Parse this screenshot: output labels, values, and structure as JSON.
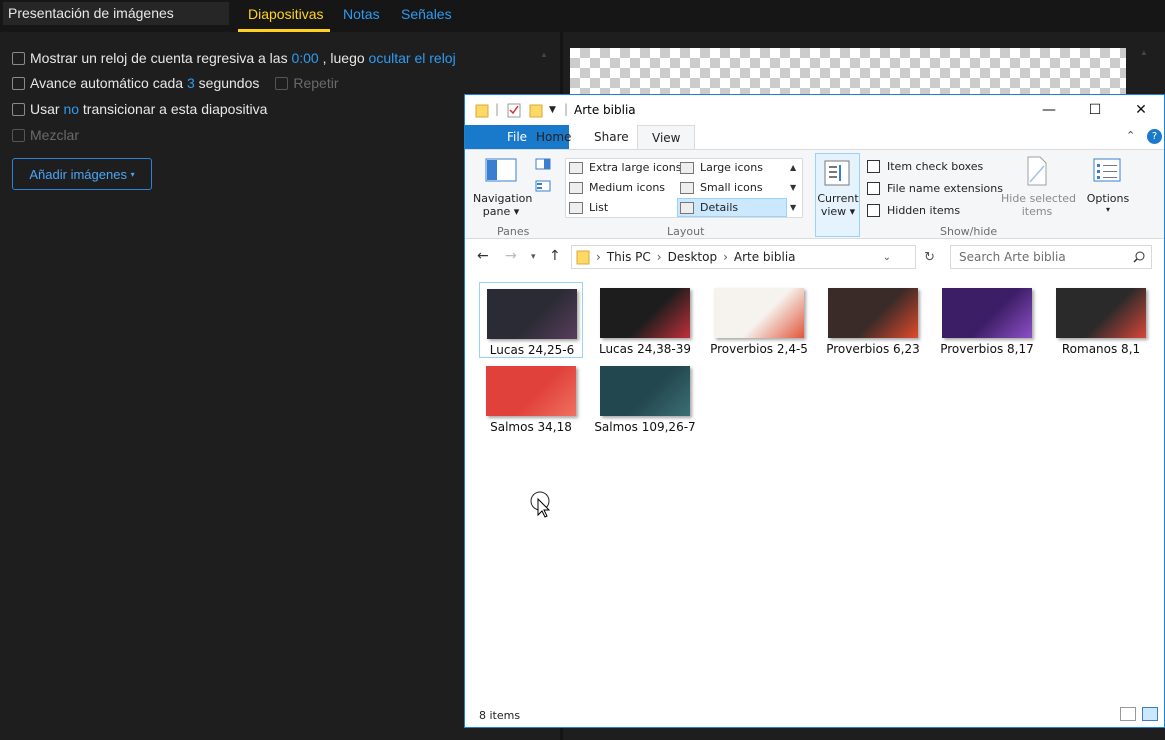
{
  "app": {
    "title_field": "Presentación de imágenes",
    "tabs": [
      "Diapositivas",
      "Notas",
      "Señales"
    ],
    "active_tab": "Diapositivas",
    "options": {
      "countdown": {
        "pre": "Mostrar un reloj de cuenta regresiva a las",
        "time": "0:00",
        "mid": ", luego",
        "link": "ocultar el reloj"
      },
      "auto_advance": {
        "pre": "Avance automático cada",
        "value": "3",
        "post": "segundos",
        "repeat": "Repetir"
      },
      "transition": {
        "pre": "Usar",
        "link": "no",
        "post": "transicionar a esta diapositiva"
      },
      "shuffle": "Mezclar"
    },
    "add_images_button": "Añadir imágenes",
    "caret": "▾"
  },
  "explorer": {
    "title": "Arte biblia",
    "controls": {
      "minimize": "—",
      "maximize": "☐",
      "close": "✕"
    },
    "ribbon_tabs": [
      "File",
      "Home",
      "Share",
      "View"
    ],
    "active_ribbon_tab": "View",
    "panes": {
      "nav_pane_line1": "Navigation",
      "nav_pane_line2": "pane",
      "group": "Panes"
    },
    "layout": {
      "items": [
        "Extra large icons",
        "Large icons",
        "Medium icons",
        "Small icons",
        "List",
        "Details"
      ],
      "selected": "Details",
      "group": "Layout"
    },
    "current_view": {
      "line1": "Current",
      "line2": "view"
    },
    "show_hide": {
      "item_check_boxes": "Item check boxes",
      "file_name_extensions": "File name extensions",
      "hidden_items": "Hidden items",
      "hide_selected_line1": "Hide selected",
      "hide_selected_line2": "items",
      "options": "Options",
      "group": "Show/hide"
    },
    "address": {
      "segments": [
        "This PC",
        "Desktop",
        "Arte biblia"
      ],
      "search_placeholder": "Search Arte biblia"
    },
    "files": [
      {
        "name": "Lucas 24,25-6",
        "colors": [
          "#2b2b35",
          "#5a3d5c"
        ]
      },
      {
        "name": "Lucas 24,38-39",
        "colors": [
          "#1d1d1d",
          "#c0303a"
        ]
      },
      {
        "name": "Proverbios 2,4-5",
        "colors": [
          "#f6f2ee",
          "#e0563a"
        ]
      },
      {
        "name": "Proverbios 6,23",
        "colors": [
          "#3a2a28",
          "#e04a2a"
        ]
      },
      {
        "name": "Proverbios 8,17",
        "colors": [
          "#3c1e66",
          "#8d4fc7"
        ]
      },
      {
        "name": "Romanos 8,1",
        "colors": [
          "#2a2a2a",
          "#d8463a"
        ]
      },
      {
        "name": "Salmos 34,18",
        "colors": [
          "#e0413a",
          "#f07060"
        ]
      },
      {
        "name": "Salmos 109,26-7",
        "colors": [
          "#23474e",
          "#3b6f74"
        ]
      }
    ],
    "status": "8 items"
  }
}
